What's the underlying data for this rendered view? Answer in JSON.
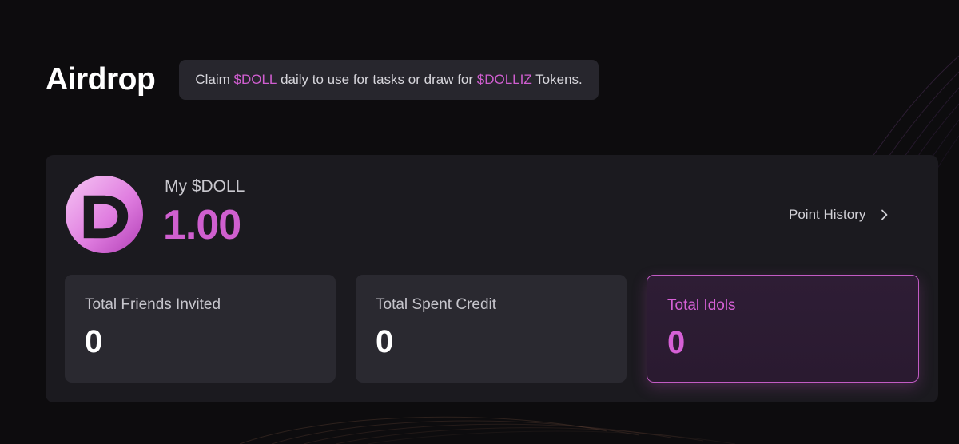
{
  "header": {
    "title": "Airdrop",
    "notice": {
      "prefix": "Claim ",
      "token_a": "$DOLL",
      "middle": " daily to use for tasks or draw for ",
      "token_b": "$DOLLIZ",
      "suffix": " Tokens."
    }
  },
  "balance": {
    "label": "My $DOLL",
    "value": "1.00",
    "logo_icon": "doll-token-logo-icon"
  },
  "history_link": {
    "label": "Point History",
    "icon": "chevron-right-icon"
  },
  "stats": [
    {
      "label": "Total Friends Invited",
      "value": "0"
    },
    {
      "label": "Total Spent Credit",
      "value": "0"
    },
    {
      "label": "Total Idols",
      "value": "0"
    }
  ],
  "colors": {
    "accent": "#d05ed0",
    "background": "#0d0c0e",
    "card": "#1b1a1f",
    "stat_card": "#2a2930",
    "notice_bg": "#27262d"
  }
}
